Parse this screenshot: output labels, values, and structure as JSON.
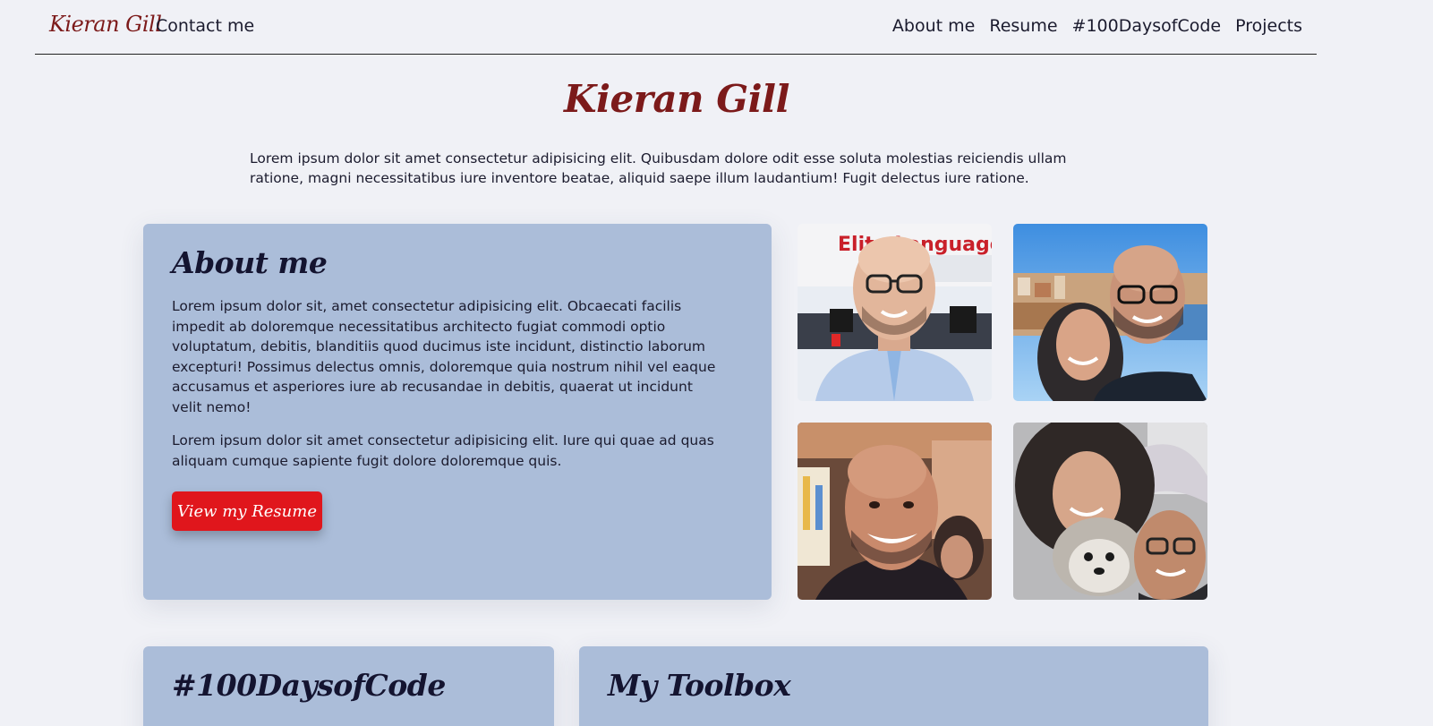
{
  "nav": {
    "brand": "Kieran Gill",
    "contact": "Contact me",
    "links": [
      "About me",
      "Resume",
      "#100DaysofCode",
      "Projects"
    ]
  },
  "hero": {
    "title": "Kieran Gill",
    "intro": "Lorem ipsum dolor sit amet consectetur adipisicing elit. Quibusdam dolore odit esse soluta molestias reiciendis ullam ratione, magni necessitatibus iure inventore beatae, aliquid saepe illum laudantium! Fugit delectus iure ratione."
  },
  "about": {
    "title": "About me",
    "paragraphs": [
      "Lorem ipsum dolor sit, amet consectetur adipisicing elit. Obcaecati facilis impedit ab doloremque necessitatibus architecto fugiat commodi optio voluptatum, debitis, blanditiis quod ducimus iste incidunt, distinctio laborum excepturi! Possimus delectus omnis, doloremque quia nostrum nihil vel eaque accusamus et asperiores iure ab recusandae in debitis, quaerat ut incidunt velit nemo!",
      "Lorem ipsum dolor sit amet consectetur adipisicing elit. Iure qui quae ad quas aliquam cumque sapiente fugit dolore doloremque quis."
    ],
    "button": "View my Resume"
  },
  "photos": {
    "p1_sign": "Elite Language Center"
  },
  "sections": {
    "days": "#100DaysofCode",
    "toolbox": "My Toolbox"
  },
  "colors": {
    "background": "#f0f1f6",
    "card": "#abbdd9",
    "accent_red": "#e0161c",
    "brand_maroon": "#7c1a1a"
  }
}
